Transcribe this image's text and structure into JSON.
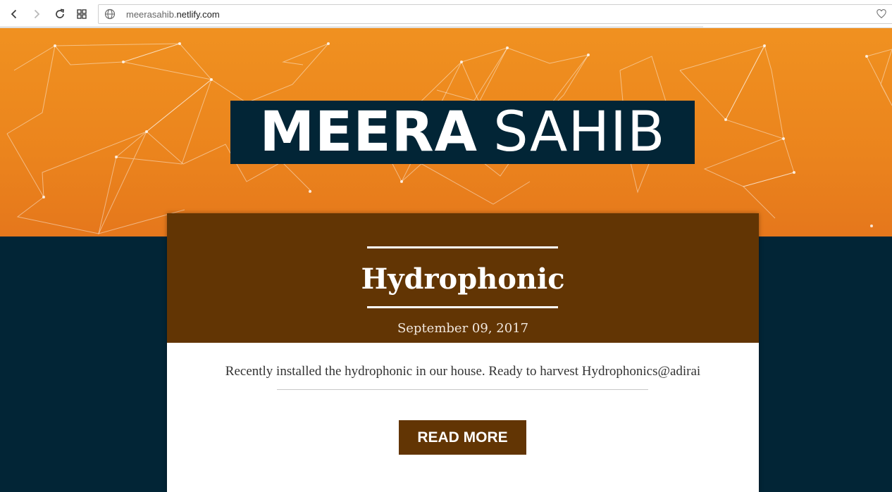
{
  "browser": {
    "back_icon": "chevron-left-icon",
    "forward_icon": "chevron-right-icon",
    "reload_icon": "reload-icon",
    "tabs_icon": "grid-icon",
    "url_prefix": "meerasahib.",
    "url_domain": "netlify.com"
  },
  "site": {
    "title_bold": "MEERA",
    "title_light": "SAHIB"
  },
  "post": {
    "title": "Hydrophonic",
    "date": "September 09, 2017",
    "excerpt": "Recently installed the hydrophonic in our house. Ready to harvest Hydrophonics@adirai",
    "read_more_label": "READ MORE"
  },
  "colors": {
    "hero_orange": "#f09120",
    "navy": "#022536",
    "brown": "#623504"
  }
}
